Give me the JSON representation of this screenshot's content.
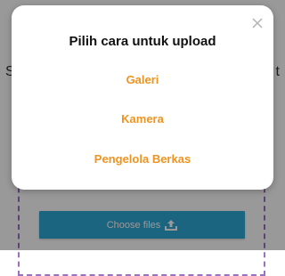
{
  "background": {
    "left_text": "S",
    "right_text": "t",
    "choose_files_label": "Choose files",
    "upload_icon": "upload-icon"
  },
  "modal": {
    "title": "Pilih cara untuk upload",
    "close_icon": "close-icon",
    "options": [
      {
        "label": "Galeri"
      },
      {
        "label": "Kamera"
      },
      {
        "label": "Pengelola Berkas"
      }
    ]
  },
  "colors": {
    "option_text": "#f0931f",
    "button_bg": "#2fa8d5",
    "dropzone_border": "#9b6fc2",
    "overlay": "rgba(0,0,0,0.4)"
  }
}
